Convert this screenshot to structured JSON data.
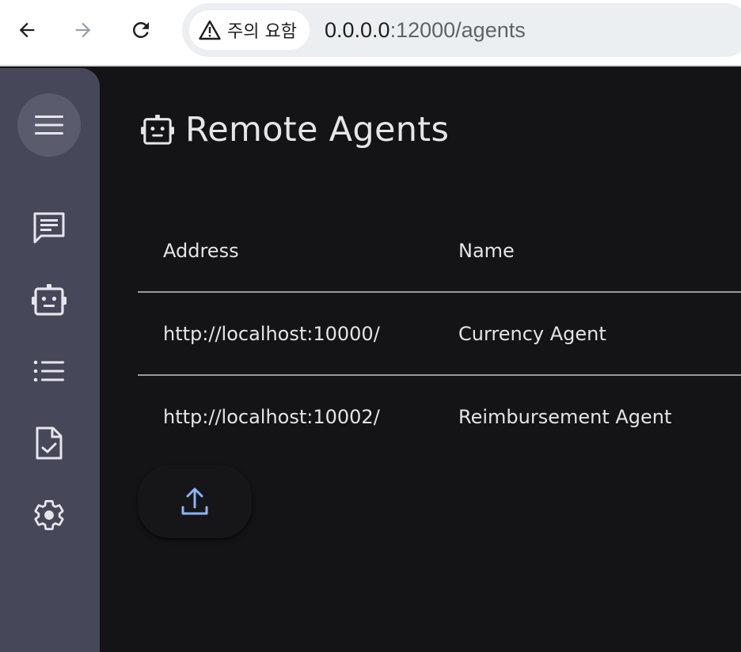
{
  "browser": {
    "security_label": "주의 요함",
    "url_host": "0.0.0.0",
    "url_path": ":12000/agents",
    "icons": [
      "back-arrow-icon",
      "forward-arrow-icon",
      "reload-icon",
      "warning-triangle-icon"
    ]
  },
  "sidebar": {
    "menu_icon": "hamburger-menu-icon",
    "items": [
      {
        "icon": "chat-icon"
      },
      {
        "icon": "robot-icon"
      },
      {
        "icon": "list-icon"
      },
      {
        "icon": "task-document-icon"
      },
      {
        "icon": "settings-gear-icon"
      }
    ],
    "background": "#464859"
  },
  "page": {
    "title": "Remote Agents",
    "title_icon": "robot-icon"
  },
  "table": {
    "columns": [
      "Address",
      "Name"
    ],
    "rows": [
      {
        "address": "http://localhost:10000/",
        "name": "Currency Agent"
      },
      {
        "address": "http://localhost:10002/",
        "name": "Reimbursement Agent"
      }
    ]
  },
  "actions": {
    "upload_icon": "upload-icon",
    "accent": "#8ab4f8"
  }
}
